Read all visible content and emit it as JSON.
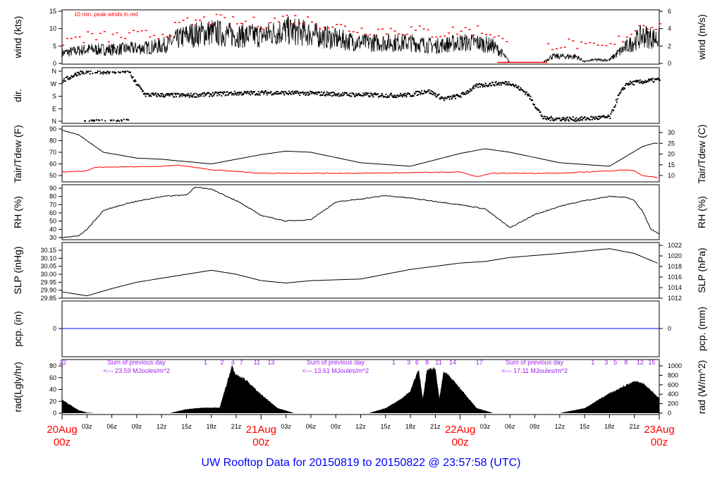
{
  "title": "UW Rooftop Data for 20150819  to  20150822 @ 23:57:58  (UTC)",
  "colors": {
    "gust": "#ff0000",
    "dew": "#ff0000",
    "pcp": "#0000ff",
    "title": "#0000ff",
    "date": "#ff0000",
    "rad_text": "#a020f0"
  },
  "chart_data": [
    {
      "type": "line",
      "name": "wind",
      "ylabel": "wind (kts)",
      "ylabel_right": "wind (m/s)",
      "ylim": [
        0,
        15
      ],
      "yticks": [
        "0",
        "5",
        "10",
        "15"
      ],
      "yticks_right": [
        "0",
        "2",
        "4",
        "6"
      ],
      "annotation": "10 min. peak winds in red",
      "x": [
        0,
        3,
        6,
        10,
        12,
        15,
        18,
        21,
        24,
        27,
        30,
        33,
        36,
        42,
        45,
        48,
        50,
        52,
        53,
        54,
        58,
        59,
        60,
        62,
        63,
        64,
        66,
        67,
        70,
        72
      ],
      "mean": [
        3,
        4,
        4,
        4.5,
        5,
        8,
        9,
        8,
        8,
        9.5,
        8.5,
        7,
        6,
        6,
        5,
        6,
        6,
        5,
        3,
        0.3,
        0.3,
        2,
        2,
        2,
        0.5,
        1,
        1,
        3,
        8,
        7
      ]
    },
    {
      "type": "scatter",
      "name": "dir",
      "ylabel": "dir.",
      "yticks": [
        "N",
        "E",
        "S",
        "W",
        "N"
      ],
      "x": [
        0,
        2,
        4,
        8,
        8.5,
        10,
        15,
        20,
        25,
        30,
        36,
        40,
        42,
        44,
        46,
        48,
        50,
        52,
        54,
        56,
        58,
        62,
        66,
        67,
        68,
        70,
        72
      ],
      "deg": [
        290,
        350,
        355,
        360,
        300,
        190,
        185,
        200,
        205,
        200,
        190,
        185,
        190,
        220,
        160,
        185,
        255,
        270,
        275,
        200,
        20,
        15,
        30,
        180,
        270,
        285,
        300
      ]
    },
    {
      "type": "line",
      "name": "temp",
      "ylabel": "Tair/Tdew (F)",
      "ylabel_right": "Tair/Tdew (C)",
      "ylim": [
        45,
        90
      ],
      "yticks": [
        "50",
        "60",
        "70",
        "80",
        "90"
      ],
      "yticks_right": [
        "10",
        "15",
        "20",
        "25",
        "30"
      ],
      "tair_x": [
        0,
        2,
        5,
        9,
        12,
        18,
        24,
        27,
        30,
        36,
        42,
        48,
        51,
        54,
        60,
        66,
        70,
        71.5,
        72
      ],
      "tair": [
        89,
        85,
        70,
        65,
        64,
        60,
        68,
        71,
        70,
        61,
        58,
        69,
        73,
        70,
        61,
        58,
        75,
        78,
        77
      ],
      "tdew_x": [
        0,
        3,
        4,
        12,
        14,
        18,
        24,
        36,
        48,
        50,
        52,
        60,
        66,
        68,
        69,
        70,
        72
      ],
      "tdew": [
        53,
        54,
        57,
        58,
        59,
        55,
        52,
        52,
        53,
        49,
        52,
        52,
        54,
        55,
        54,
        50,
        48
      ]
    },
    {
      "type": "line",
      "name": "rh",
      "ylabel": "RH (%)",
      "ylabel_right": "RH (%)",
      "ylim": [
        28,
        92
      ],
      "yticks": [
        "30",
        "40",
        "50",
        "60",
        "70",
        "80",
        "90"
      ],
      "x": [
        0,
        2,
        3,
        5,
        8,
        12,
        15,
        16,
        18,
        21,
        24,
        27,
        30,
        33,
        36,
        39,
        42,
        48,
        51,
        54,
        57,
        60,
        63,
        66,
        68,
        69,
        70,
        71,
        72
      ],
      "rh": [
        30,
        32,
        40,
        63,
        72,
        80,
        82,
        91,
        89,
        75,
        57,
        50,
        52,
        73,
        77,
        81,
        78,
        70,
        65,
        42,
        58,
        68,
        75,
        80,
        79,
        75,
        62,
        40,
        35
      ]
    },
    {
      "type": "line",
      "name": "slp",
      "ylabel": "SLP (inHg)",
      "ylabel_right": "SLP (hPa)",
      "ylim": [
        29.85,
        30.17
      ],
      "yticks": [
        "29.85",
        "29.90",
        "29.95",
        "30.00",
        "30.05",
        "30.10",
        "30.15"
      ],
      "yticks_right": [
        "1012",
        "1014",
        "1016",
        "1018",
        "1020",
        "1022"
      ],
      "x": [
        0,
        3,
        6,
        9,
        15,
        18,
        21,
        24,
        27,
        30,
        36,
        42,
        48,
        51,
        54,
        60,
        66,
        69,
        72
      ],
      "slp": [
        29.89,
        29.865,
        29.91,
        29.95,
        30.0,
        30.025,
        30.0,
        29.96,
        29.945,
        29.96,
        29.97,
        30.03,
        30.07,
        30.08,
        30.105,
        30.13,
        30.16,
        30.13,
        30.065
      ]
    },
    {
      "type": "line",
      "name": "pcp",
      "ylabel": "pcp. (in)",
      "ylabel_right": "pcp. (mm)",
      "yticks": [
        "0"
      ],
      "yticks_right": [
        "0"
      ],
      "value": 0
    },
    {
      "type": "area",
      "name": "rad",
      "ylabel": "rad(Lgly/hr)",
      "ylabel_right": "rad (W/m^2)",
      "ylim": [
        0,
        1000
      ],
      "yticks": [
        "0",
        "20",
        "40",
        "60",
        "80"
      ],
      "yticks_right": [
        "0",
        "200",
        "400",
        "600",
        "800",
        "1000"
      ],
      "x": [
        0,
        2,
        3,
        4,
        13,
        15,
        17,
        19,
        19.5,
        20.5,
        21,
        22,
        24,
        26,
        28,
        37,
        39,
        40,
        41,
        42,
        43,
        43.5,
        44,
        45,
        45.5,
        46,
        47,
        48,
        50,
        52,
        60,
        63,
        66,
        69,
        70,
        72
      ],
      "rad": [
        270,
        60,
        10,
        0,
        0,
        80,
        110,
        110,
        400,
        950,
        780,
        700,
        380,
        100,
        0,
        0,
        100,
        200,
        300,
        450,
        900,
        300,
        880,
        900,
        300,
        850,
        700,
        500,
        100,
        0,
        0,
        100,
        400,
        650,
        620,
        300
      ],
      "markers": [
        {
          "t": 0.1,
          "label": "22"
        },
        {
          "t": 17.3,
          "label": "1"
        },
        {
          "t": 19.3,
          "label": "2"
        },
        {
          "t": 20.6,
          "label": "4"
        },
        {
          "t": 21.6,
          "label": "7"
        },
        {
          "t": 23.5,
          "label": "11"
        },
        {
          "t": 25.2,
          "label": "13"
        },
        {
          "t": 40,
          "label": "1"
        },
        {
          "t": 41.8,
          "label": "3"
        },
        {
          "t": 42.8,
          "label": "6"
        },
        {
          "t": 44,
          "label": "8"
        },
        {
          "t": 45.4,
          "label": "11"
        },
        {
          "t": 47.1,
          "label": "14"
        },
        {
          "t": 50.3,
          "label": "17"
        },
        {
          "t": 64,
          "label": "1"
        },
        {
          "t": 65.6,
          "label": "3"
        },
        {
          "t": 66.7,
          "label": "5"
        },
        {
          "t": 68,
          "label": "8"
        },
        {
          "t": 69.7,
          "label": "12"
        },
        {
          "t": 71.1,
          "label": "15"
        }
      ],
      "sums": [
        {
          "t": 6,
          "line1": "Sum of previous day",
          "line2": "<--- 23.59 MJoules/m^2"
        },
        {
          "t": 30,
          "line1": "Sum of previous day",
          "line2": "<--- 13.61 MJoules/m^2"
        },
        {
          "t": 54,
          "line1": "Sum of previous day",
          "line2": "<--- 17.11 MJoules/m^2"
        }
      ]
    }
  ],
  "xaxis": {
    "hour_ticks": [
      "03z",
      "06z",
      "09z",
      "12z",
      "15z",
      "18z",
      "21z"
    ],
    "days": [
      {
        "t": 0,
        "date": "20Aug",
        "hour": "00z"
      },
      {
        "t": 24,
        "date": "21Aug",
        "hour": "00z"
      },
      {
        "t": 48,
        "date": "22Aug",
        "hour": "00z"
      },
      {
        "t": 72,
        "date": "23Aug",
        "hour": "00z"
      }
    ]
  }
}
